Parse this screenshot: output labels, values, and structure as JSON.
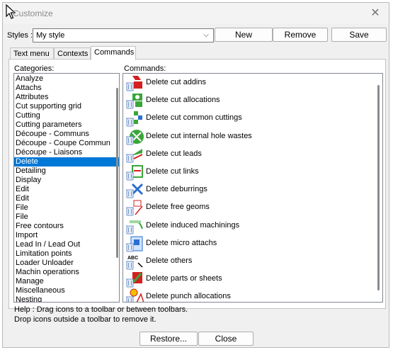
{
  "window": {
    "title": "Customize",
    "close_glyph": "✕"
  },
  "styles": {
    "label": "Styles :",
    "value": "My style",
    "arrow": "⌵"
  },
  "buttons": {
    "new": "New",
    "remove": "Remove",
    "save": "Save",
    "restore": "Restore...",
    "close": "Close"
  },
  "tabs": [
    {
      "label": "Text menu",
      "active": false
    },
    {
      "label": "Contexts",
      "active": false
    },
    {
      "label": "Commands",
      "active": true
    }
  ],
  "categories": {
    "label": "Categories:",
    "selected": "Delete",
    "items": [
      "Analyze",
      "Attachs",
      "Attributes",
      "Cut supporting grid",
      "Cutting",
      "Cutting parameters",
      "Découpe - Communs",
      "Découpe - Coupe Commun",
      "Découpe - Liaisons",
      "Delete",
      "Detailing",
      "Display",
      "Edit",
      "Edit",
      "File",
      "File",
      "Free contours",
      "Import",
      "Lead In / Lead Out",
      "Limitation points",
      "Loader Unloader",
      "Machin operations",
      "Manage",
      "Miscellaneous",
      "Nesting"
    ]
  },
  "commands": {
    "label": "Commands:",
    "items": [
      {
        "label": "Delete cut addins",
        "icon": "delete-cut-addins-icon"
      },
      {
        "label": "Delete cut allocations",
        "icon": "delete-cut-allocations-icon"
      },
      {
        "label": "Delete cut common cuttings",
        "icon": "delete-common-cuttings-icon"
      },
      {
        "label": "Delete cut internal hole wastes",
        "icon": "delete-hole-wastes-icon"
      },
      {
        "label": "Delete cut leads",
        "icon": "delete-cut-leads-icon"
      },
      {
        "label": "Delete cut links",
        "icon": "delete-cut-links-icon"
      },
      {
        "label": "Delete deburrings",
        "icon": "delete-deburrings-icon"
      },
      {
        "label": "Delete free geoms",
        "icon": "delete-free-geoms-icon"
      },
      {
        "label": "Delete induced machinings",
        "icon": "delete-induced-machinings-icon"
      },
      {
        "label": "Delete micro attachs",
        "icon": "delete-micro-attachs-icon"
      },
      {
        "label": "Delete others",
        "icon": "delete-others-icon",
        "icon_text": "ABC"
      },
      {
        "label": "Delete parts or sheets",
        "icon": "delete-parts-icon"
      },
      {
        "label": "Delete punch allocations",
        "icon": "delete-punch-allocations-icon"
      }
    ]
  },
  "help": {
    "line1": "Help : Drag icons to a toolbar or between toolbars.",
    "line2": "Drop icons outside a toolbar to remove it."
  },
  "colors": {
    "selection": "#0078d7",
    "accent_green": "#3aa63a",
    "accent_red": "#d42020",
    "accent_blue": "#2a6fd0",
    "trash_blue": "#6f93c8"
  }
}
